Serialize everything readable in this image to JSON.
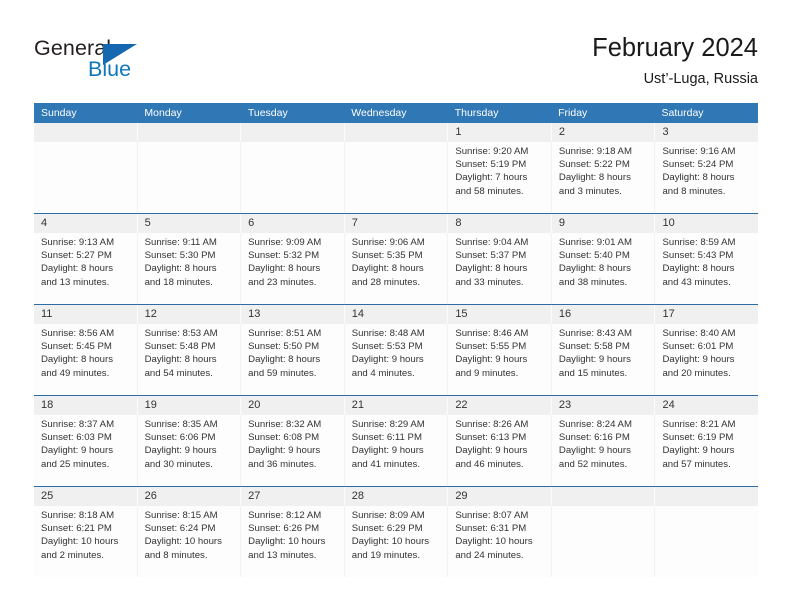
{
  "brand": {
    "name_part1": "General",
    "name_part2": "Blue",
    "triangle_icon": "brand-triangle-icon",
    "color_dark": "#231f20",
    "color_blue": "#1076bc"
  },
  "header": {
    "title": "February 2024",
    "subtitle": "Ust’-Luga, Russia"
  },
  "theme": {
    "header_blue": "#3077b6",
    "divider_blue": "#2e6da4",
    "date_band_gray": "#f0f0f0",
    "text_color": "#333333"
  },
  "calendar": {
    "weekday_headers": [
      "Sunday",
      "Monday",
      "Tuesday",
      "Wednesday",
      "Thursday",
      "Friday",
      "Saturday"
    ],
    "weeks": [
      [
        {
          "day": "",
          "lines": []
        },
        {
          "day": "",
          "lines": []
        },
        {
          "day": "",
          "lines": []
        },
        {
          "day": "",
          "lines": []
        },
        {
          "day": "1",
          "lines": [
            "Sunrise: 9:20 AM",
            "Sunset: 5:19 PM",
            "Daylight: 7 hours",
            "and 58 minutes."
          ]
        },
        {
          "day": "2",
          "lines": [
            "Sunrise: 9:18 AM",
            "Sunset: 5:22 PM",
            "Daylight: 8 hours",
            "and 3 minutes."
          ]
        },
        {
          "day": "3",
          "lines": [
            "Sunrise: 9:16 AM",
            "Sunset: 5:24 PM",
            "Daylight: 8 hours",
            "and 8 minutes."
          ]
        }
      ],
      [
        {
          "day": "4",
          "lines": [
            "Sunrise: 9:13 AM",
            "Sunset: 5:27 PM",
            "Daylight: 8 hours",
            "and 13 minutes."
          ]
        },
        {
          "day": "5",
          "lines": [
            "Sunrise: 9:11 AM",
            "Sunset: 5:30 PM",
            "Daylight: 8 hours",
            "and 18 minutes."
          ]
        },
        {
          "day": "6",
          "lines": [
            "Sunrise: 9:09 AM",
            "Sunset: 5:32 PM",
            "Daylight: 8 hours",
            "and 23 minutes."
          ]
        },
        {
          "day": "7",
          "lines": [
            "Sunrise: 9:06 AM",
            "Sunset: 5:35 PM",
            "Daylight: 8 hours",
            "and 28 minutes."
          ]
        },
        {
          "day": "8",
          "lines": [
            "Sunrise: 9:04 AM",
            "Sunset: 5:37 PM",
            "Daylight: 8 hours",
            "and 33 minutes."
          ]
        },
        {
          "day": "9",
          "lines": [
            "Sunrise: 9:01 AM",
            "Sunset: 5:40 PM",
            "Daylight: 8 hours",
            "and 38 minutes."
          ]
        },
        {
          "day": "10",
          "lines": [
            "Sunrise: 8:59 AM",
            "Sunset: 5:43 PM",
            "Daylight: 8 hours",
            "and 43 minutes."
          ]
        }
      ],
      [
        {
          "day": "11",
          "lines": [
            "Sunrise: 8:56 AM",
            "Sunset: 5:45 PM",
            "Daylight: 8 hours",
            "and 49 minutes."
          ]
        },
        {
          "day": "12",
          "lines": [
            "Sunrise: 8:53 AM",
            "Sunset: 5:48 PM",
            "Daylight: 8 hours",
            "and 54 minutes."
          ]
        },
        {
          "day": "13",
          "lines": [
            "Sunrise: 8:51 AM",
            "Sunset: 5:50 PM",
            "Daylight: 8 hours",
            "and 59 minutes."
          ]
        },
        {
          "day": "14",
          "lines": [
            "Sunrise: 8:48 AM",
            "Sunset: 5:53 PM",
            "Daylight: 9 hours",
            "and 4 minutes."
          ]
        },
        {
          "day": "15",
          "lines": [
            "Sunrise: 8:46 AM",
            "Sunset: 5:55 PM",
            "Daylight: 9 hours",
            "and 9 minutes."
          ]
        },
        {
          "day": "16",
          "lines": [
            "Sunrise: 8:43 AM",
            "Sunset: 5:58 PM",
            "Daylight: 9 hours",
            "and 15 minutes."
          ]
        },
        {
          "day": "17",
          "lines": [
            "Sunrise: 8:40 AM",
            "Sunset: 6:01 PM",
            "Daylight: 9 hours",
            "and 20 minutes."
          ]
        }
      ],
      [
        {
          "day": "18",
          "lines": [
            "Sunrise: 8:37 AM",
            "Sunset: 6:03 PM",
            "Daylight: 9 hours",
            "and 25 minutes."
          ]
        },
        {
          "day": "19",
          "lines": [
            "Sunrise: 8:35 AM",
            "Sunset: 6:06 PM",
            "Daylight: 9 hours",
            "and 30 minutes."
          ]
        },
        {
          "day": "20",
          "lines": [
            "Sunrise: 8:32 AM",
            "Sunset: 6:08 PM",
            "Daylight: 9 hours",
            "and 36 minutes."
          ]
        },
        {
          "day": "21",
          "lines": [
            "Sunrise: 8:29 AM",
            "Sunset: 6:11 PM",
            "Daylight: 9 hours",
            "and 41 minutes."
          ]
        },
        {
          "day": "22",
          "lines": [
            "Sunrise: 8:26 AM",
            "Sunset: 6:13 PM",
            "Daylight: 9 hours",
            "and 46 minutes."
          ]
        },
        {
          "day": "23",
          "lines": [
            "Sunrise: 8:24 AM",
            "Sunset: 6:16 PM",
            "Daylight: 9 hours",
            "and 52 minutes."
          ]
        },
        {
          "day": "24",
          "lines": [
            "Sunrise: 8:21 AM",
            "Sunset: 6:19 PM",
            "Daylight: 9 hours",
            "and 57 minutes."
          ]
        }
      ],
      [
        {
          "day": "25",
          "lines": [
            "Sunrise: 8:18 AM",
            "Sunset: 6:21 PM",
            "Daylight: 10 hours",
            "and 2 minutes."
          ]
        },
        {
          "day": "26",
          "lines": [
            "Sunrise: 8:15 AM",
            "Sunset: 6:24 PM",
            "Daylight: 10 hours",
            "and 8 minutes."
          ]
        },
        {
          "day": "27",
          "lines": [
            "Sunrise: 8:12 AM",
            "Sunset: 6:26 PM",
            "Daylight: 10 hours",
            "and 13 minutes."
          ]
        },
        {
          "day": "28",
          "lines": [
            "Sunrise: 8:09 AM",
            "Sunset: 6:29 PM",
            "Daylight: 10 hours",
            "and 19 minutes."
          ]
        },
        {
          "day": "29",
          "lines": [
            "Sunrise: 8:07 AM",
            "Sunset: 6:31 PM",
            "Daylight: 10 hours",
            "and 24 minutes."
          ]
        },
        {
          "day": "",
          "lines": []
        },
        {
          "day": "",
          "lines": []
        }
      ]
    ]
  }
}
